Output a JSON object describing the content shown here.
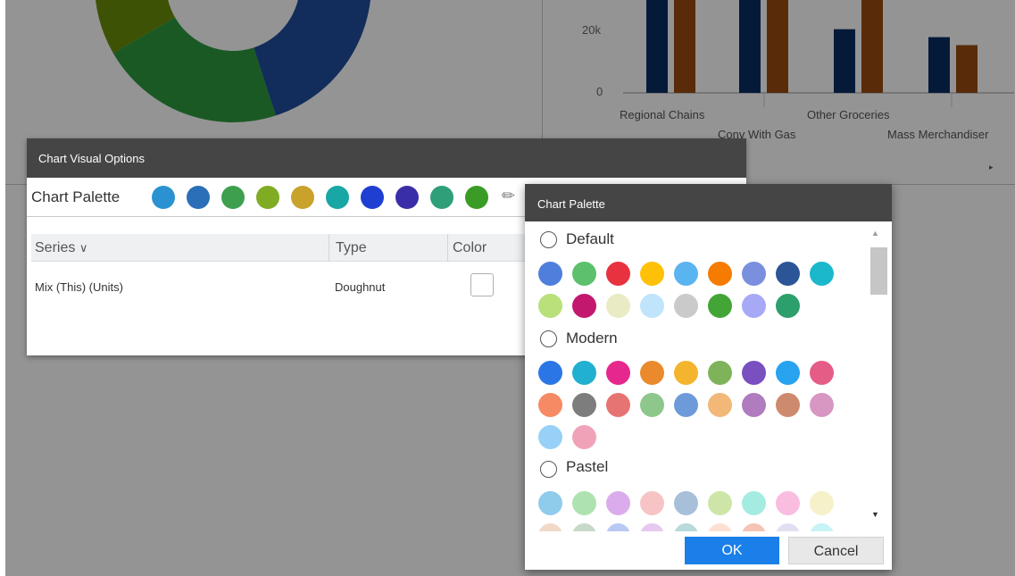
{
  "background": {
    "donut_chart": {
      "type": "pie",
      "segments": [
        {
          "color": "#1f4e9e"
        },
        {
          "color": "#2e9a3e"
        },
        {
          "color": "#6c8d0c"
        }
      ]
    },
    "bar_chart": {
      "y_ticks": [
        "20k",
        "0"
      ],
      "categories_row1": [
        "Regional Chains",
        "Other Groceries"
      ],
      "categories_row2": [
        "Conv With Gas",
        "Mass Merchandiser"
      ],
      "chart_data": {
        "type": "bar",
        "ylim": [
          0,
          35000
        ],
        "groups": [
          {
            "series_a": 35000,
            "series_b": 35000
          },
          {
            "series_a": 35000,
            "series_b": 35000
          },
          {
            "series_a": 24000,
            "series_b": 35000
          },
          {
            "series_a": 21000,
            "series_b": 18000
          }
        ],
        "series_colors": [
          "#0a2e63",
          "#9a4a10"
        ]
      }
    },
    "scroll_arrow": "▸"
  },
  "chart_visual_options": {
    "title": "Chart Visual Options",
    "palette_label": "Chart Palette",
    "palette_colors": [
      "#2a92d0",
      "#2a6fb7",
      "#3ea04f",
      "#7fac23",
      "#c9a22c",
      "#18a7a4",
      "#1f3ed2",
      "#3a2ea8",
      "#2e9f78",
      "#3a9c26"
    ],
    "edit_icon": "pencil-icon",
    "grid": {
      "headers": {
        "series": "Series",
        "type": "Type",
        "color": "Color"
      },
      "rows": [
        {
          "series": "Mix (This) (Units)",
          "type": "Doughnut"
        }
      ]
    }
  },
  "chart_palette": {
    "title": "Chart Palette",
    "palettes": [
      {
        "name": "Default",
        "colors": [
          "#4f7fdc",
          "#5cc06c",
          "#e8323f",
          "#ffc107",
          "#5ab4ef",
          "#f57c00",
          "#7b8fdf",
          "#2c5597",
          "#1bb8cc",
          "#b9e07a",
          "#c2186e",
          "#e9ebc4",
          "#bfe4fb",
          "#cacaca",
          "#43a535",
          "#a7a9f7",
          "#2c9f6c"
        ]
      },
      {
        "name": "Modern",
        "colors": [
          "#2b76e6",
          "#21b0cf",
          "#e6288e",
          "#ea8a2c",
          "#f4b42e",
          "#7fb35a",
          "#7a4fc0",
          "#27a3ef",
          "#e55c86",
          "#f68a64",
          "#7d7d7d",
          "#e67472",
          "#8dc78b",
          "#6d9bd9",
          "#f1b878",
          "#b07bbf",
          "#cd8a6e",
          "#d896c3",
          "#97d1f7",
          "#f0a3b8"
        ]
      },
      {
        "name": "Pastel",
        "colors": [
          "#8fcbeb",
          "#aee3b1",
          "#dbaceb",
          "#f6c4c4",
          "#a7bfd9",
          "#cde6a8",
          "#a4ece2",
          "#f9bde0",
          "#f6f1c9",
          "#f2d9c7",
          "#c7d9c7",
          "#b9c9f3",
          "#e6c9ee",
          "#b9dada",
          "#fce0d2",
          "#f5c4b5",
          "#e1e0f3",
          "#c8f3f6"
        ]
      }
    ],
    "ok_label": "OK",
    "cancel_label": "Cancel"
  }
}
